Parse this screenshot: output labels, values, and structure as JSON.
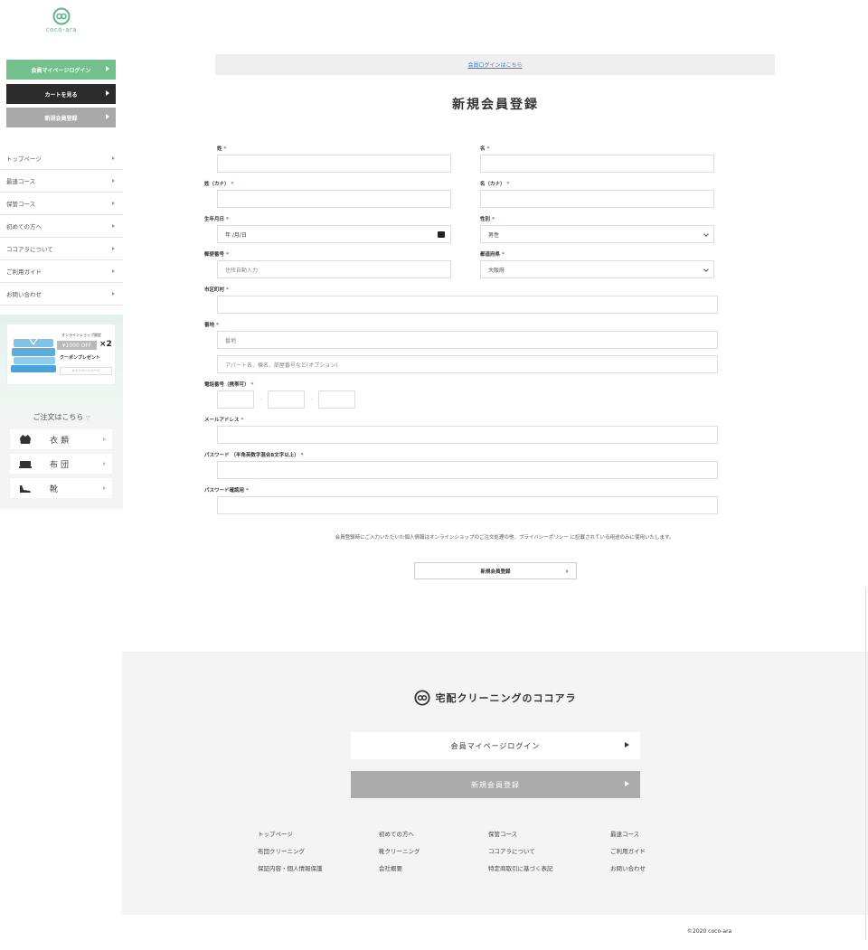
{
  "brand": {
    "logo_text": "coco-ara",
    "name": "宅配クリーニングのココアラ"
  },
  "sidebar": {
    "buttons": {
      "login": "会員マイページログイン",
      "cart": "カートを見る",
      "register": "新規会員登録"
    },
    "nav": [
      "トップページ",
      "最速コース",
      "保管コース",
      "初めての方へ",
      "ココアラについて",
      "ご利用ガイド",
      "お問い合わせ"
    ],
    "banner": {
      "small": "オンラインショップ限定",
      "price": "¥1000 OFF",
      "times": "×2",
      "coupon": "クーポンプレゼント",
      "mini": "キャンペーンページ"
    },
    "order_title": "ご注文はこちら",
    "order_items": [
      "衣類",
      "布団",
      "靴"
    ]
  },
  "main": {
    "login_link": "会員ログインはこちら",
    "title": "新規会員登録",
    "fields": {
      "sei": "姓",
      "mei": "名",
      "sei_kana": "姓（カナ）",
      "mei_kana": "名（カナ）",
      "birthday": "生年月日",
      "birthday_value": "年 /月/日",
      "gender": "性別",
      "gender_value": "男性",
      "postal": "郵便番号",
      "postal_placeholder": "住所自動入力",
      "prefecture": "都道府県",
      "prefecture_value": "大阪府",
      "city": "市区町村",
      "address": "番地",
      "address_placeholder": "番地",
      "building_placeholder": "アパート名、棟名、部屋番号など(オプション)",
      "phone": "電話番号（携帯可）",
      "email": "メールアドレス",
      "password": "パスワード （半角英数字混合8文字以上）",
      "password_confirm": "パスワード確認用"
    },
    "required_mark": "*",
    "phone_separator": "-",
    "notice": "会員登録時にご入力いただいた個人情報はオンラインショップのご注文処理の他、プライバシーポリシー に記載されている用途のみに使用いたします。",
    "submit": "新規会員登録"
  },
  "footer": {
    "login_button": "会員マイページログイン",
    "register_button": "新規会員登録",
    "links": [
      "トップページ",
      "初めての方へ",
      "保管コース",
      "最速コース",
      "布団クリーニング",
      "靴クリーニング",
      "ココアラについて",
      "ご利用ガイド",
      "保証内容・個人情報保護",
      "会社概要",
      "特定商取引に基づく表記",
      "お問い合わせ"
    ],
    "copyright": "©2020 coco-ara"
  }
}
